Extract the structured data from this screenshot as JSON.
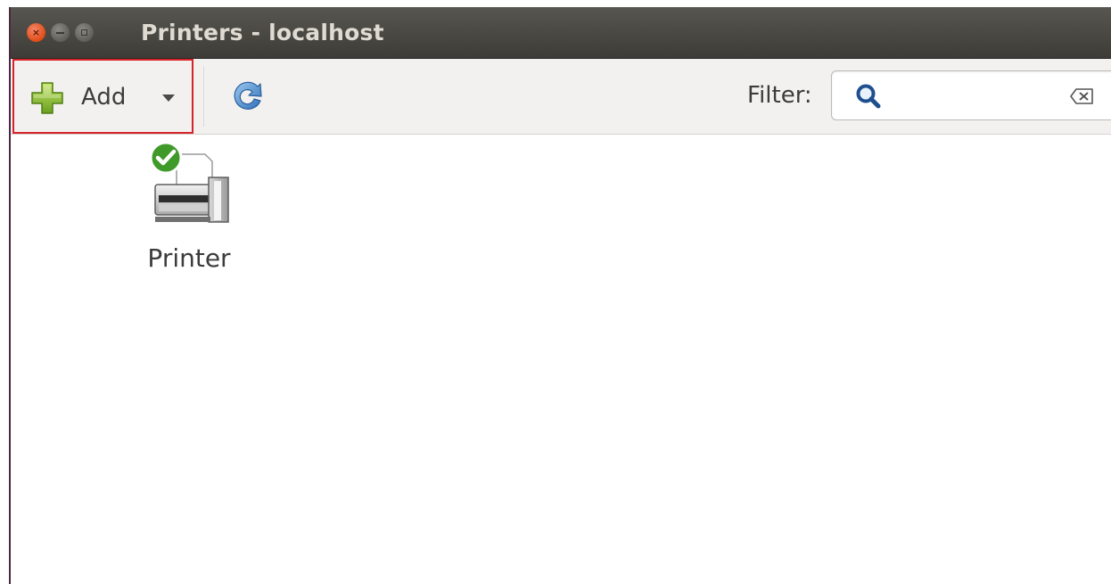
{
  "window": {
    "title": "Printers - localhost",
    "controls": {
      "close": "×"
    }
  },
  "toolbar": {
    "add_label": "Add",
    "filter_label": "Filter:",
    "filter_value": "",
    "filter_placeholder": ""
  },
  "printers": [
    {
      "name": "Printer",
      "status_icon": "check-icon"
    }
  ],
  "colors": {
    "titlebar": "#3d3c37",
    "close_button": "#df4b16",
    "highlight_box": "#d6242b",
    "toolbar_bg": "#f2f1f0"
  },
  "icons": {
    "add": "green-plus-icon",
    "refresh": "refresh-icon",
    "search": "search-icon",
    "clear": "clear-icon",
    "printer": "printer-icon"
  }
}
